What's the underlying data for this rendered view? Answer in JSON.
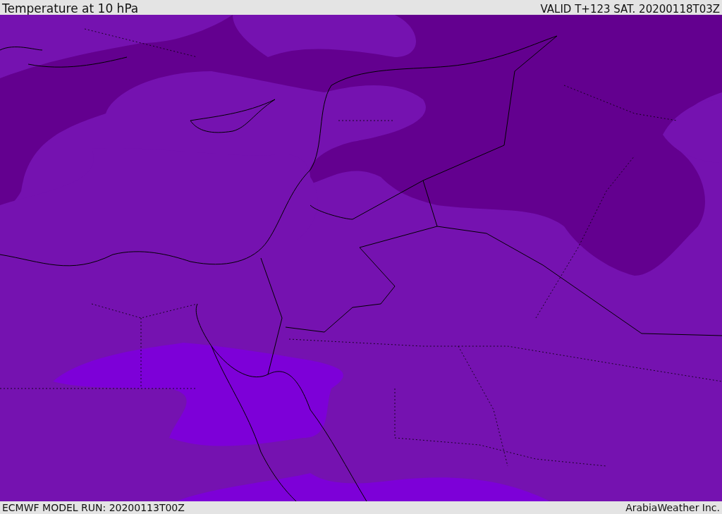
{
  "header": {
    "title": "Temperature at 10 hPa",
    "valid": "VALID T+123 SAT. 20200118T03Z"
  },
  "footer": {
    "model_run": "ECMWF MODEL RUN: 20200113T00Z",
    "credit": "ArabiaWeather Inc."
  }
}
